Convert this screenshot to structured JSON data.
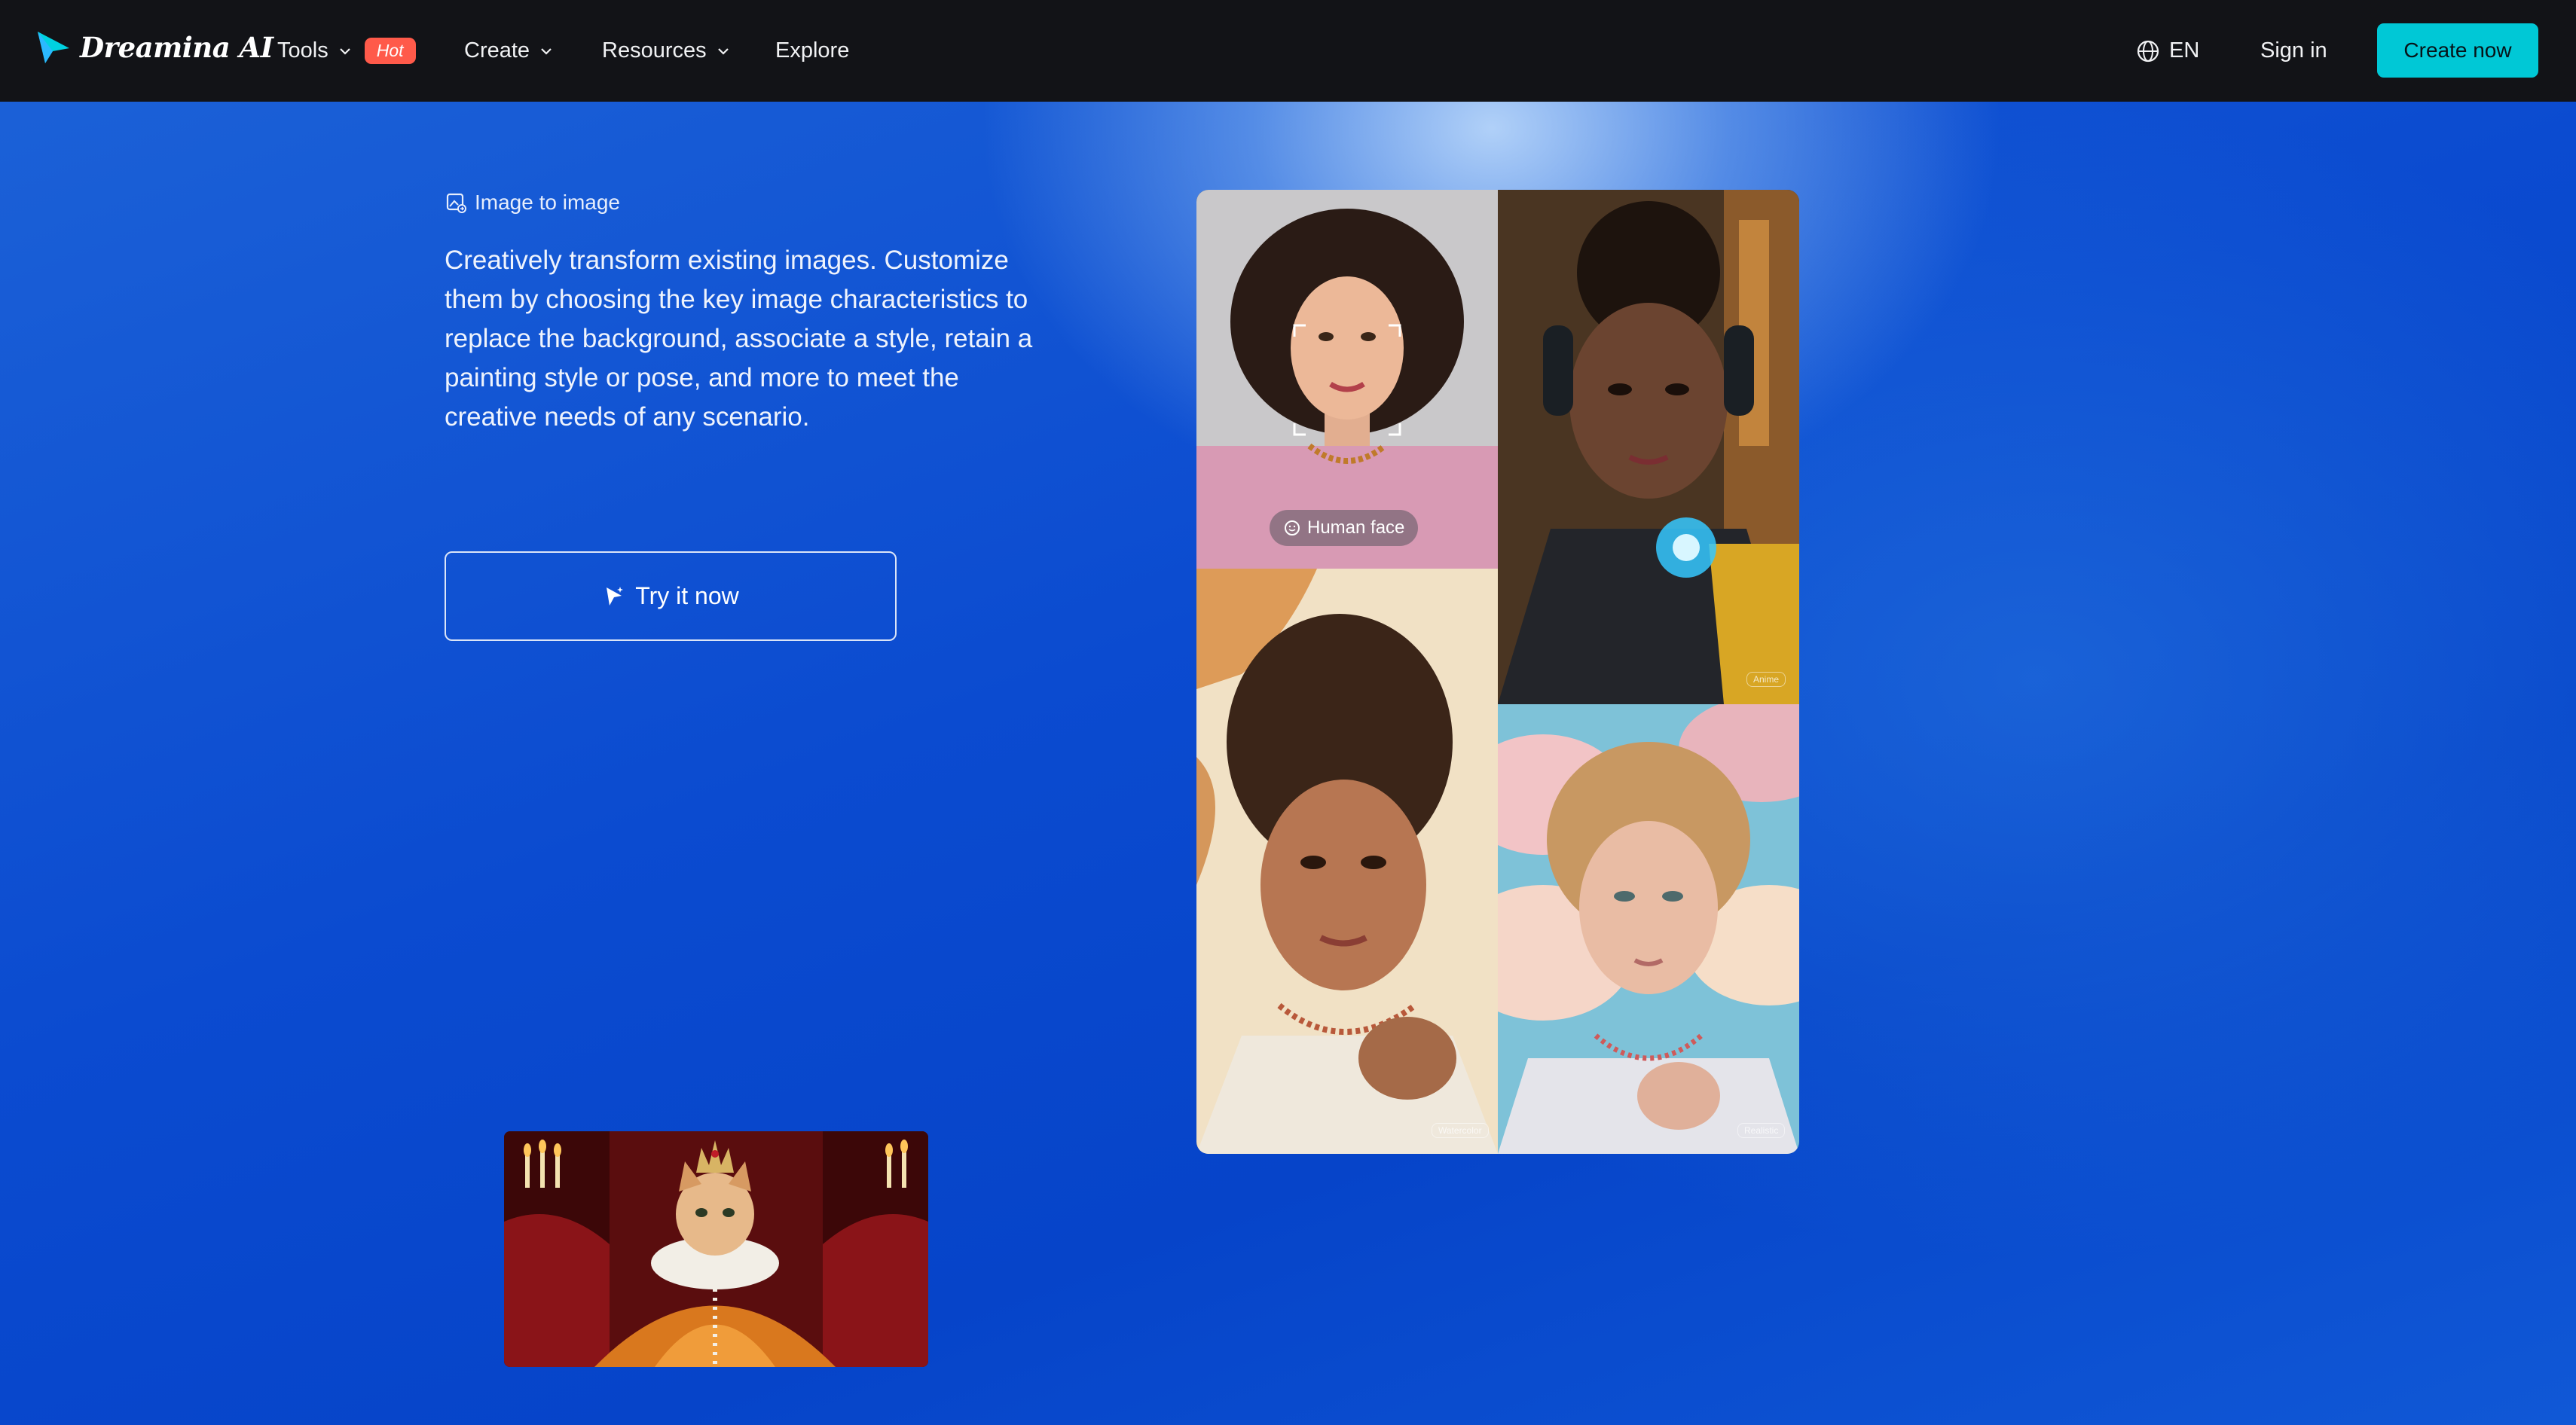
{
  "brand": {
    "name": "Dreamina AI",
    "accent": "#00c8d6"
  },
  "nav": {
    "items": [
      {
        "label": "Tools",
        "badge": "Hot",
        "has_dropdown": true
      },
      {
        "label": "Create",
        "has_dropdown": true
      },
      {
        "label": "Resources",
        "has_dropdown": true
      },
      {
        "label": "Explore",
        "has_dropdown": false
      }
    ],
    "language": "EN",
    "sign_in": "Sign in",
    "cta": "Create now"
  },
  "feature": {
    "tag": "Image to image",
    "description": "Creatively transform existing images. Customize them by choosing the key image characteristics to replace the background, associate a style, retain a painting style or pose, and more to meet the creative needs of any scenario.",
    "button": "Try it now"
  },
  "gallery": {
    "face_label": "Human face",
    "style_labels": [
      "Anime",
      "Watercolor",
      "Realistic"
    ]
  }
}
